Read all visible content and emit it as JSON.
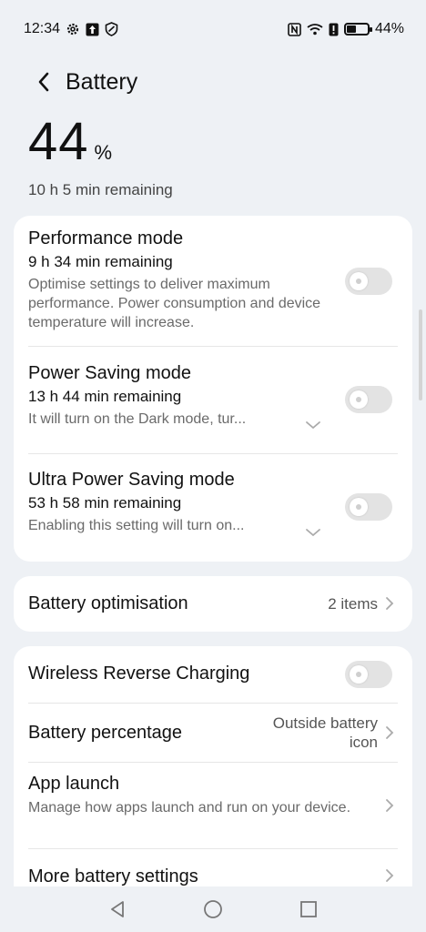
{
  "status_bar": {
    "time": "12:34",
    "battery_text": "44%",
    "battery_level": 0.44,
    "left_icons": [
      "gear-icon",
      "upload-icon",
      "shield-icon"
    ],
    "right_icons": [
      "nfc-icon",
      "wifi-icon",
      "alert-icon",
      "battery-icon"
    ]
  },
  "header": {
    "title": "Battery",
    "back_icon": "chevron-left-icon"
  },
  "battery": {
    "level": "44",
    "unit": "%",
    "remaining": "10 h 5 min remaining"
  },
  "modes": [
    {
      "title": "Performance mode",
      "remaining": "9 h 34 min remaining",
      "description": "Optimise settings to deliver maximum performance. Power consumption and device temperature will increase.",
      "enabled": false
    },
    {
      "title": "Power Saving mode",
      "remaining": "13 h 44 min remaining",
      "description": "It will turn on the Dark mode, tur...",
      "enabled": false
    },
    {
      "title": "Ultra Power Saving mode",
      "remaining": "53 h 58 min remaining",
      "description": "Enabling this setting will turn on...",
      "enabled": false
    }
  ],
  "optimisation": {
    "title": "Battery optimisation",
    "value": "2 items"
  },
  "settings": {
    "wireless_reverse": {
      "title": "Wireless Reverse Charging",
      "enabled": false
    },
    "battery_percentage": {
      "title": "Battery percentage",
      "value_line1": "Outside battery",
      "value_line2": "icon"
    },
    "app_launch": {
      "title": "App launch",
      "description": "Manage how apps launch and run on your device."
    },
    "more": {
      "title": "More battery settings"
    }
  },
  "nav": [
    "back-triangle-icon",
    "home-circle-icon",
    "recents-square-icon"
  ],
  "colors": {
    "background": "#eef1f5",
    "card": "#ffffff",
    "toggle_off": "#e3e3e3"
  }
}
